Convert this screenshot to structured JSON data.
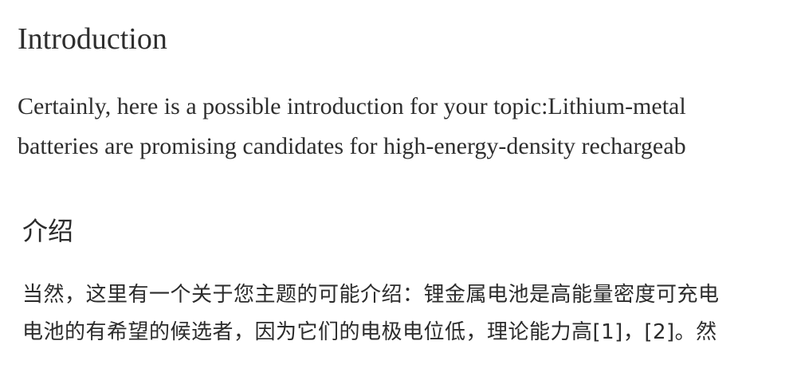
{
  "english": {
    "heading": "Introduction",
    "lines": [
      "Certainly, here is a possible introduction for your topic:Lithium-metal",
      "batteries are promising candidates for high-energy-density rechargeab"
    ]
  },
  "chinese": {
    "heading": "介绍",
    "lines": [
      "当然，这里有一个关于您主题的可能介绍：锂金属电池是高能量密度可充电",
      "电池的有希望的候选者，因为它们的电极电位低，理论能力高[1]，[2]。然"
    ]
  }
}
